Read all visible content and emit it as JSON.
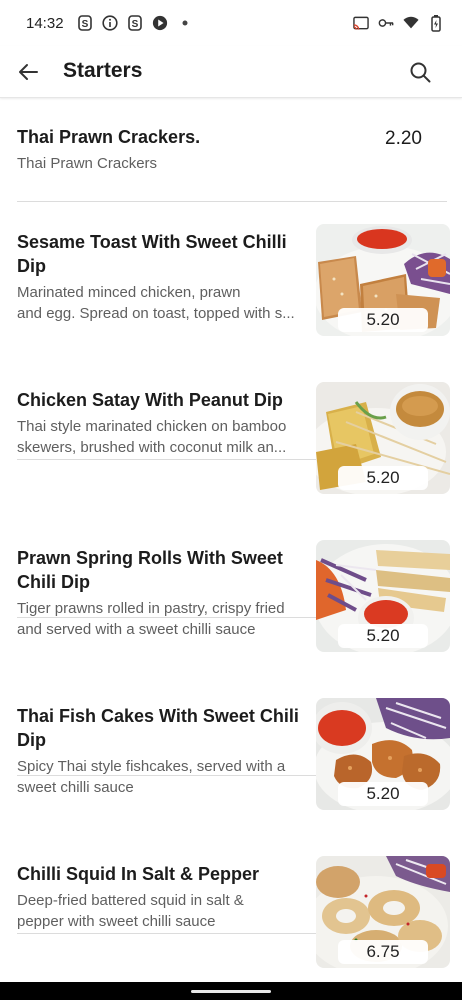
{
  "status": {
    "time": "14:32",
    "left_icons": [
      "s-notification-icon",
      "info-icon",
      "s-notification-icon",
      "media-app-icon",
      "dot-icon"
    ],
    "right_icons": [
      "cast-icon",
      "vpn-key-icon",
      "wifi-icon",
      "battery-icon"
    ]
  },
  "app_bar": {
    "title": "Starters"
  },
  "items": [
    {
      "name_line1": "Thai Prawn Crackers.",
      "name_line2": "",
      "desc_line1": "Thai Prawn Crackers",
      "desc_line2": "",
      "price": "2.20"
    },
    {
      "name_line1": "Sesame Toast With Sweet Chilli",
      "name_line2": "Dip",
      "desc_line1": "Marinated minced chicken, prawn",
      "desc_line2": "and egg. Spread on toast, topped with s...",
      "price": "5.20"
    },
    {
      "name_line1": "Chicken Satay With Peanut Dip",
      "name_line2": "",
      "desc_line1": "Thai style marinated chicken on bamboo",
      "desc_line2": "skewers, brushed with coconut milk an...",
      "price": "5.20"
    },
    {
      "name_line1": "Prawn Spring Rolls With Sweet",
      "name_line2": "Chili Dip",
      "desc_line1": "Tiger prawns rolled in pastry, crispy fried",
      "desc_line2": "and served with a sweet chilli sauce",
      "price": "5.20"
    },
    {
      "name_line1": "Thai Fish Cakes With Sweet Chili",
      "name_line2": "Dip",
      "desc_line1": "Spicy Thai style fishcakes, served with a",
      "desc_line2": "sweet chilli sauce",
      "price": "5.20"
    },
    {
      "name_line1": "Chilli Squid In Salt & Pepper",
      "name_line2": "",
      "desc_line1": "Deep-fried battered squid in salt &",
      "desc_line2": "pepper with sweet chilli sauce",
      "price": "6.75"
    }
  ]
}
